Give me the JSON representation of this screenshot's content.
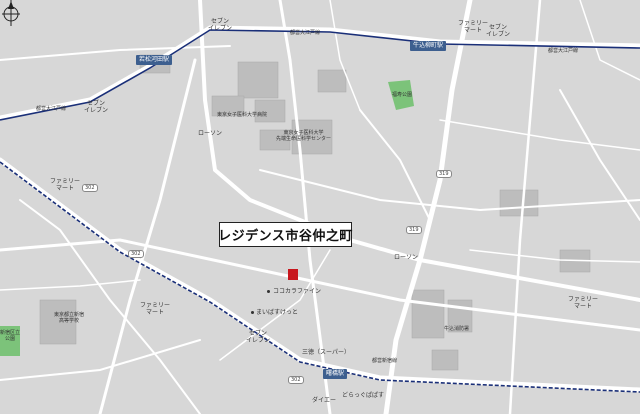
{
  "colors": {
    "background": "#d7d7d7",
    "road": "#ffffff",
    "building": "#bdbdbd",
    "rail": "#1a2f78",
    "station": "#3d5f8f",
    "park": "#7cc37a",
    "target": "#c8161d"
  },
  "title": "レジデンス市谷仲之町",
  "stations": [
    {
      "name": "若松河田駅"
    },
    {
      "name": "牛込柳町駅"
    },
    {
      "name": "曙橋駅"
    }
  ],
  "rail_line_label": "都営大江戸線",
  "rail_line_label_2": "都営新宿線",
  "labels": {
    "seven_top": "セブン\nイレブン",
    "family_top_right": "ファミリー\nマート",
    "seven_top_right": "セブン\nイレブン",
    "seven_left": "セブン\nイレブン",
    "tokyo_women_hospital": "東京女子医科大学病院",
    "tokyo_women_center": "東京女子医科大学\n先端生命医科学センター",
    "lawson_top": "ローソン",
    "family_left": "ファミリー\nマート",
    "fukuju_park": "福寿公園",
    "cocokara": "ココカラファイン",
    "lawson_right": "ローソン",
    "family_right": "ファミリー\nマート",
    "family_bottom": "ファミリー\nマート",
    "maibasket": "まいばすけっと",
    "seven_bottom": "セブン\nイレブン",
    "sanko": "三徳（スーパー）",
    "school": "東京都立新宿\n高等学校",
    "daiei": "ダイエー",
    "drugstore": "どらっぐぱぱす",
    "fire": "牛込消防署",
    "shinjuku_park": "新宿区立\n公園"
  },
  "routes": [
    "302",
    "302",
    "319",
    "319",
    "302"
  ]
}
